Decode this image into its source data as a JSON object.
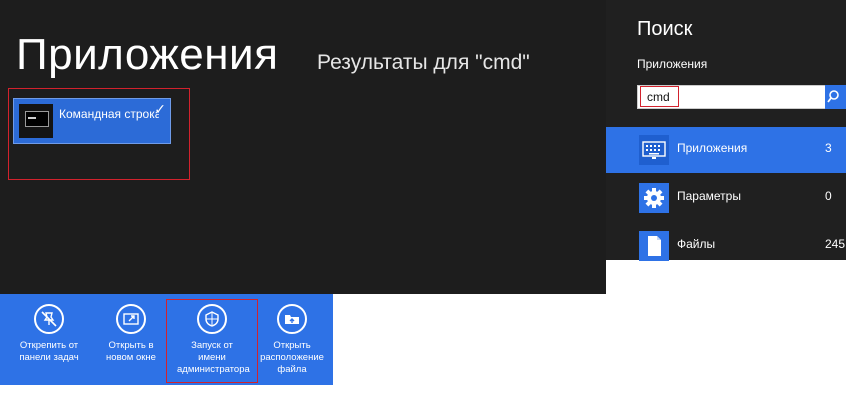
{
  "main": {
    "title": "Приложения",
    "results_label": "Результаты для \"cmd\"",
    "tile": {
      "label": "Командная строка",
      "check": "✓",
      "icon": "command-prompt-icon"
    }
  },
  "appbar": {
    "buttons": [
      {
        "label": "Открепить от\nпанели задач",
        "icon": "unpin-icon"
      },
      {
        "label": "Открыть в\nновом окне",
        "icon": "new-window-icon"
      },
      {
        "label": "Запуск от имени\nадминистратора",
        "icon": "shield-icon"
      },
      {
        "label": "Открыть\nрасположение\nфайла",
        "icon": "open-folder-icon"
      }
    ]
  },
  "search": {
    "title": "Поиск",
    "scope": "Приложения",
    "query": "cmd",
    "clear": "✕",
    "results": [
      {
        "label": "Приложения",
        "count": "3",
        "icon": "keyboard-icon",
        "selected": true
      },
      {
        "label": "Параметры",
        "count": "0",
        "icon": "gear-icon",
        "selected": false
      },
      {
        "label": "Файлы",
        "count": "245",
        "icon": "file-icon",
        "selected": false
      }
    ]
  },
  "colors": {
    "accent": "#2e72e6",
    "background": "#1d1d1d",
    "highlight": "#d2222d"
  }
}
